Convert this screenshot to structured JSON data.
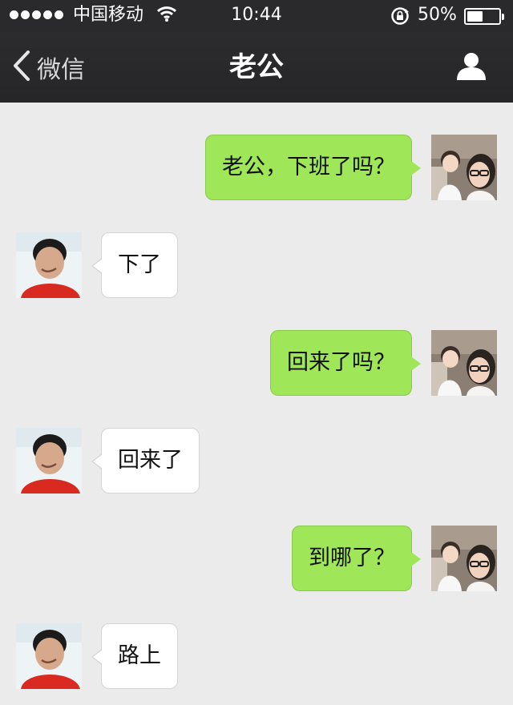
{
  "status_bar": {
    "signal_dots": 5,
    "carrier": "中国移动",
    "time": "10:44",
    "battery_percent_label": "50%",
    "battery_level": 0.5,
    "icons": [
      "signal-icon",
      "wifi-icon",
      "rotation-lock-icon",
      "battery-icon"
    ]
  },
  "nav": {
    "back_label": "微信",
    "title": "老公",
    "icons": [
      "chevron-left-icon",
      "person-icon"
    ]
  },
  "messages": [
    {
      "sender": "self",
      "text": "老公，下班了吗？"
    },
    {
      "sender": "contact",
      "text": "下了"
    },
    {
      "sender": "self",
      "text": "回来了吗？"
    },
    {
      "sender": "contact",
      "text": "回来了"
    },
    {
      "sender": "self",
      "text": "到哪了？"
    },
    {
      "sender": "contact",
      "text": "路上"
    }
  ],
  "colors": {
    "chat_background": "#ebebeb",
    "bar_background": "#2a2a2c",
    "outgoing_bubble": "#9fe658",
    "incoming_bubble": "#ffffff"
  }
}
